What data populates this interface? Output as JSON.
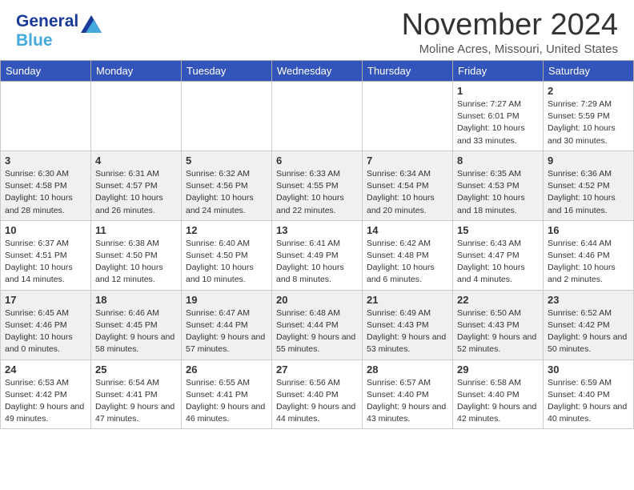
{
  "header": {
    "logo_line1": "General",
    "logo_line2": "Blue",
    "month_title": "November 2024",
    "location": "Moline Acres, Missouri, United States"
  },
  "calendar": {
    "days_of_week": [
      "Sunday",
      "Monday",
      "Tuesday",
      "Wednesday",
      "Thursday",
      "Friday",
      "Saturday"
    ],
    "weeks": [
      [
        {
          "day": "",
          "info": ""
        },
        {
          "day": "",
          "info": ""
        },
        {
          "day": "",
          "info": ""
        },
        {
          "day": "",
          "info": ""
        },
        {
          "day": "",
          "info": ""
        },
        {
          "day": "1",
          "info": "Sunrise: 7:27 AM\nSunset: 6:01 PM\nDaylight: 10 hours\nand 33 minutes."
        },
        {
          "day": "2",
          "info": "Sunrise: 7:29 AM\nSunset: 5:59 PM\nDaylight: 10 hours\nand 30 minutes."
        }
      ],
      [
        {
          "day": "3",
          "info": "Sunrise: 6:30 AM\nSunset: 4:58 PM\nDaylight: 10 hours\nand 28 minutes."
        },
        {
          "day": "4",
          "info": "Sunrise: 6:31 AM\nSunset: 4:57 PM\nDaylight: 10 hours\nand 26 minutes."
        },
        {
          "day": "5",
          "info": "Sunrise: 6:32 AM\nSunset: 4:56 PM\nDaylight: 10 hours\nand 24 minutes."
        },
        {
          "day": "6",
          "info": "Sunrise: 6:33 AM\nSunset: 4:55 PM\nDaylight: 10 hours\nand 22 minutes."
        },
        {
          "day": "7",
          "info": "Sunrise: 6:34 AM\nSunset: 4:54 PM\nDaylight: 10 hours\nand 20 minutes."
        },
        {
          "day": "8",
          "info": "Sunrise: 6:35 AM\nSunset: 4:53 PM\nDaylight: 10 hours\nand 18 minutes."
        },
        {
          "day": "9",
          "info": "Sunrise: 6:36 AM\nSunset: 4:52 PM\nDaylight: 10 hours\nand 16 minutes."
        }
      ],
      [
        {
          "day": "10",
          "info": "Sunrise: 6:37 AM\nSunset: 4:51 PM\nDaylight: 10 hours\nand 14 minutes."
        },
        {
          "day": "11",
          "info": "Sunrise: 6:38 AM\nSunset: 4:50 PM\nDaylight: 10 hours\nand 12 minutes."
        },
        {
          "day": "12",
          "info": "Sunrise: 6:40 AM\nSunset: 4:50 PM\nDaylight: 10 hours\nand 10 minutes."
        },
        {
          "day": "13",
          "info": "Sunrise: 6:41 AM\nSunset: 4:49 PM\nDaylight: 10 hours\nand 8 minutes."
        },
        {
          "day": "14",
          "info": "Sunrise: 6:42 AM\nSunset: 4:48 PM\nDaylight: 10 hours\nand 6 minutes."
        },
        {
          "day": "15",
          "info": "Sunrise: 6:43 AM\nSunset: 4:47 PM\nDaylight: 10 hours\nand 4 minutes."
        },
        {
          "day": "16",
          "info": "Sunrise: 6:44 AM\nSunset: 4:46 PM\nDaylight: 10 hours\nand 2 minutes."
        }
      ],
      [
        {
          "day": "17",
          "info": "Sunrise: 6:45 AM\nSunset: 4:46 PM\nDaylight: 10 hours\nand 0 minutes."
        },
        {
          "day": "18",
          "info": "Sunrise: 6:46 AM\nSunset: 4:45 PM\nDaylight: 9 hours\nand 58 minutes."
        },
        {
          "day": "19",
          "info": "Sunrise: 6:47 AM\nSunset: 4:44 PM\nDaylight: 9 hours\nand 57 minutes."
        },
        {
          "day": "20",
          "info": "Sunrise: 6:48 AM\nSunset: 4:44 PM\nDaylight: 9 hours\nand 55 minutes."
        },
        {
          "day": "21",
          "info": "Sunrise: 6:49 AM\nSunset: 4:43 PM\nDaylight: 9 hours\nand 53 minutes."
        },
        {
          "day": "22",
          "info": "Sunrise: 6:50 AM\nSunset: 4:43 PM\nDaylight: 9 hours\nand 52 minutes."
        },
        {
          "day": "23",
          "info": "Sunrise: 6:52 AM\nSunset: 4:42 PM\nDaylight: 9 hours\nand 50 minutes."
        }
      ],
      [
        {
          "day": "24",
          "info": "Sunrise: 6:53 AM\nSunset: 4:42 PM\nDaylight: 9 hours\nand 49 minutes."
        },
        {
          "day": "25",
          "info": "Sunrise: 6:54 AM\nSunset: 4:41 PM\nDaylight: 9 hours\nand 47 minutes."
        },
        {
          "day": "26",
          "info": "Sunrise: 6:55 AM\nSunset: 4:41 PM\nDaylight: 9 hours\nand 46 minutes."
        },
        {
          "day": "27",
          "info": "Sunrise: 6:56 AM\nSunset: 4:40 PM\nDaylight: 9 hours\nand 44 minutes."
        },
        {
          "day": "28",
          "info": "Sunrise: 6:57 AM\nSunset: 4:40 PM\nDaylight: 9 hours\nand 43 minutes."
        },
        {
          "day": "29",
          "info": "Sunrise: 6:58 AM\nSunset: 4:40 PM\nDaylight: 9 hours\nand 42 minutes."
        },
        {
          "day": "30",
          "info": "Sunrise: 6:59 AM\nSunset: 4:40 PM\nDaylight: 9 hours\nand 40 minutes."
        }
      ]
    ]
  }
}
